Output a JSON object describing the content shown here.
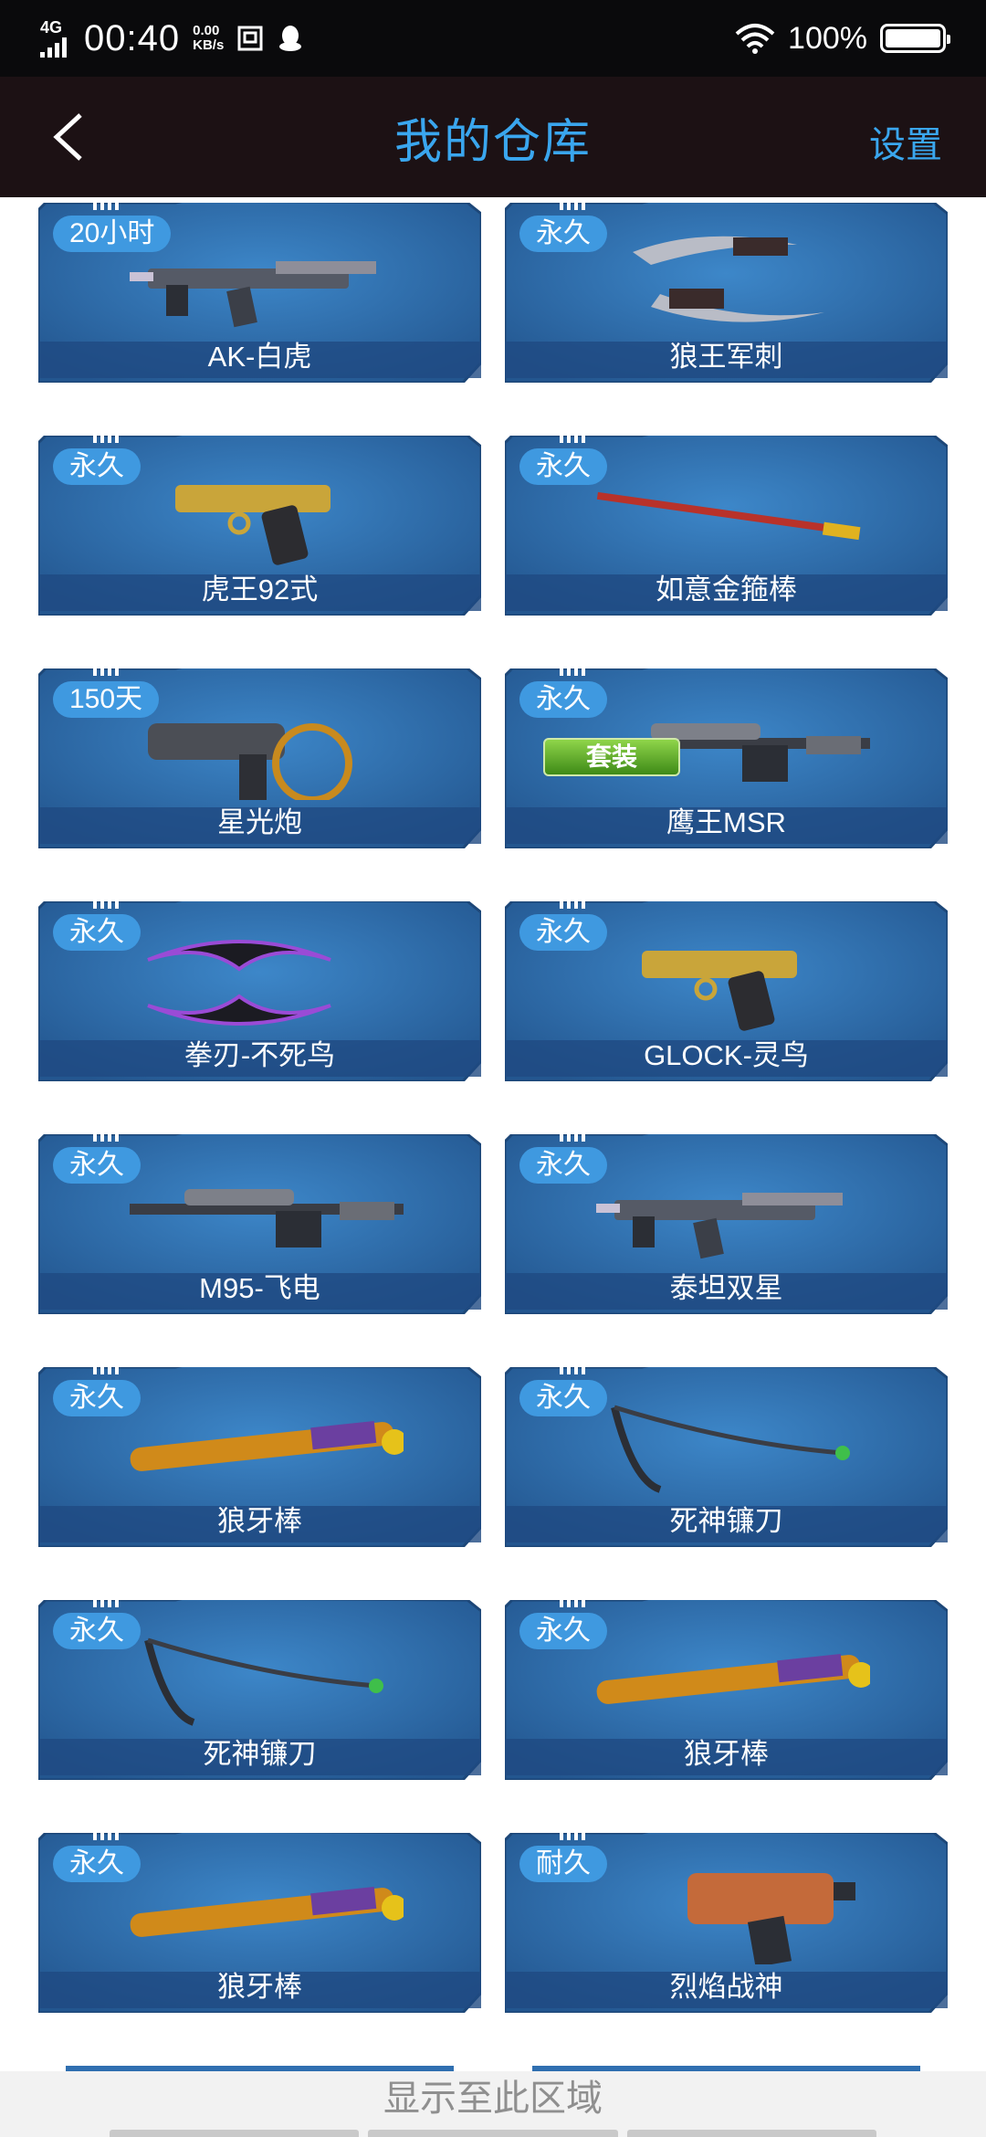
{
  "status": {
    "network": "4G",
    "time": "00:40",
    "speed_value": "0.00",
    "speed_unit": "KB/s",
    "battery": "100%"
  },
  "header": {
    "title": "我的仓库",
    "settings": "设置"
  },
  "colors": {
    "accent": "#3aa6ee",
    "card_blue": "#2f6fb0",
    "tag_blue": "#3f99e0"
  },
  "items": [
    {
      "tag": "20小时",
      "name": "AK-白虎",
      "icon": "rifle-icon"
    },
    {
      "tag": "永久",
      "name": "狼王军刺",
      "icon": "blades-icon"
    },
    {
      "tag": "永久",
      "name": "虎王92式",
      "icon": "pistol-icon"
    },
    {
      "tag": "永久",
      "name": "如意金箍棒",
      "icon": "staff-icon"
    },
    {
      "tag": "150天",
      "name": "星光炮",
      "icon": "cannon-icon"
    },
    {
      "tag": "永久",
      "name": "鹰王MSR",
      "icon": "sniper-icon",
      "badge": "套装"
    },
    {
      "tag": "永久",
      "name": "拳刃-不死鸟",
      "icon": "claw-blades-icon"
    },
    {
      "tag": "永久",
      "name": "GLOCK-灵鸟",
      "icon": "pistol-icon"
    },
    {
      "tag": "永久",
      "name": "M95-飞电",
      "icon": "sniper-icon"
    },
    {
      "tag": "永久",
      "name": "泰坦双星",
      "icon": "rifle-icon"
    },
    {
      "tag": "永久",
      "name": "狼牙棒",
      "icon": "club-icon"
    },
    {
      "tag": "永久",
      "name": "死神镰刀",
      "icon": "scythe-icon"
    },
    {
      "tag": "永久",
      "name": "死神镰刀",
      "icon": "scythe-icon"
    },
    {
      "tag": "永久",
      "name": "狼牙棒",
      "icon": "club-icon"
    },
    {
      "tag": "永久",
      "name": "狼牙棒",
      "icon": "club-icon"
    },
    {
      "tag": "耐久",
      "name": "烈焰战神",
      "icon": "blaster-icon"
    }
  ],
  "bottom": {
    "text": "显示至此区域"
  }
}
